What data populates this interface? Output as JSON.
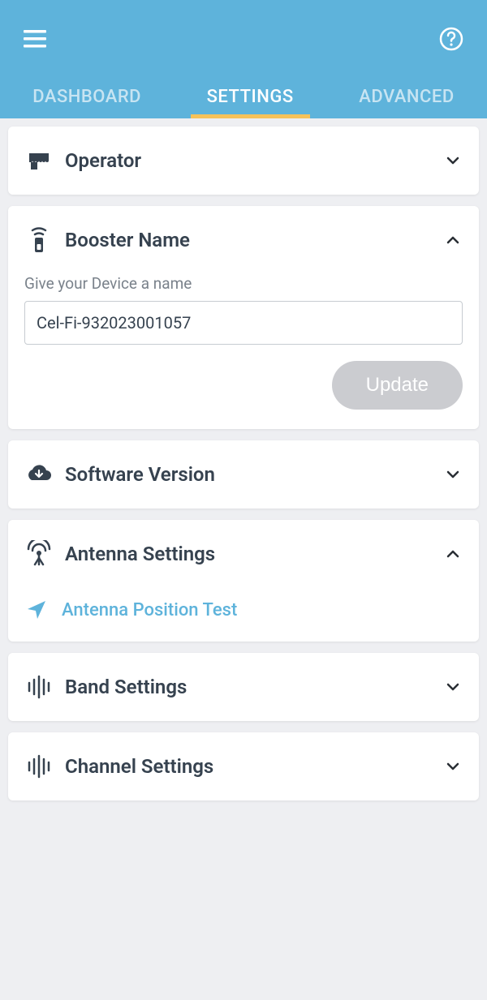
{
  "tabs": {
    "dashboard": "DASHBOARD",
    "settings": "SETTINGS",
    "advanced": "ADVANCED",
    "active": "settings"
  },
  "cards": {
    "operator": {
      "title": "Operator"
    },
    "boosterName": {
      "title": "Booster Name",
      "fieldLabel": "Give your Device a name",
      "value": "Cel-Fi-932023001057",
      "updateLabel": "Update"
    },
    "softwareVersion": {
      "title": "Software Version"
    },
    "antennaSettings": {
      "title": "Antenna Settings",
      "linkLabel": "Antenna Position Test"
    },
    "bandSettings": {
      "title": "Band Settings"
    },
    "channelSettings": {
      "title": "Channel Settings"
    }
  },
  "colors": {
    "primary": "#5eb3db",
    "accent": "#f6c259",
    "text": "#36424f",
    "muted": "#7a828b",
    "disabled": "#cbccd0"
  }
}
